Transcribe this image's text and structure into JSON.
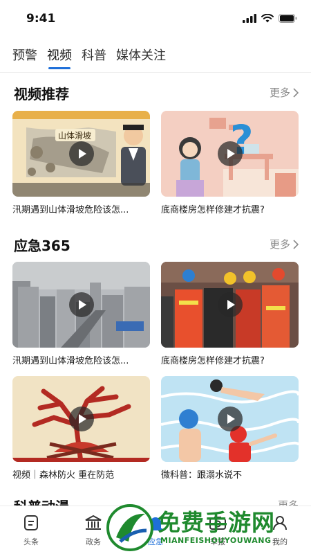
{
  "status_bar": {
    "time": "9:41"
  },
  "tabs": [
    {
      "label": "预警",
      "active": false
    },
    {
      "label": "视频",
      "active": true
    },
    {
      "label": "科普",
      "active": false
    },
    {
      "label": "媒体关注",
      "active": false
    }
  ],
  "sections": [
    {
      "title": "视频推荐",
      "more": "更多",
      "videos": [
        {
          "title": "汛期遇到山体滑坡危险该怎...",
          "thumb_text": "山体滑坡"
        },
        {
          "title": "底商楼房怎样修建才抗震?"
        }
      ]
    },
    {
      "title": "应急365",
      "more": "更多",
      "videos": [
        {
          "title": "汛期遇到山体滑坡危险该怎..."
        },
        {
          "title": "底商楼房怎样修建才抗震?"
        },
        {
          "title": "视频｜森林防火 重在防范"
        },
        {
          "title": "微科普：跟溺水说不"
        }
      ]
    }
  ],
  "partial_section": {
    "title": "科普动漫",
    "more": "更多"
  },
  "bottom_nav": [
    {
      "label": "头条",
      "icon": "document-icon"
    },
    {
      "label": "政务",
      "icon": "government-building-icon"
    },
    {
      "label": "应急",
      "icon": "emergency-icon",
      "active": true
    },
    {
      "label": "举报",
      "icon": "camera-icon"
    },
    {
      "label": "我的",
      "icon": "person-icon"
    }
  ],
  "watermark": {
    "title": "免费手游网",
    "subtitle": "MIANFEISHOUYOUWANG"
  },
  "colors": {
    "accent": "#1e6fd9",
    "watermark_green": "#1f8a2e"
  }
}
